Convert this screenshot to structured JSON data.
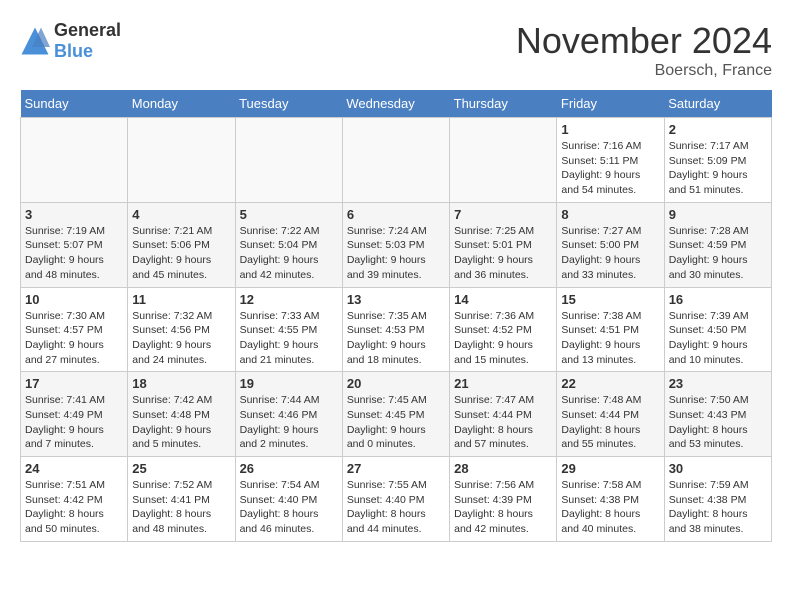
{
  "header": {
    "logo_general": "General",
    "logo_blue": "Blue",
    "title": "November 2024",
    "location": "Boersch, France"
  },
  "weekdays": [
    "Sunday",
    "Monday",
    "Tuesday",
    "Wednesday",
    "Thursday",
    "Friday",
    "Saturday"
  ],
  "weeks": [
    [
      {
        "day": "",
        "info": ""
      },
      {
        "day": "",
        "info": ""
      },
      {
        "day": "",
        "info": ""
      },
      {
        "day": "",
        "info": ""
      },
      {
        "day": "",
        "info": ""
      },
      {
        "day": "1",
        "info": "Sunrise: 7:16 AM\nSunset: 5:11 PM\nDaylight: 9 hours and 54 minutes."
      },
      {
        "day": "2",
        "info": "Sunrise: 7:17 AM\nSunset: 5:09 PM\nDaylight: 9 hours and 51 minutes."
      }
    ],
    [
      {
        "day": "3",
        "info": "Sunrise: 7:19 AM\nSunset: 5:07 PM\nDaylight: 9 hours and 48 minutes."
      },
      {
        "day": "4",
        "info": "Sunrise: 7:21 AM\nSunset: 5:06 PM\nDaylight: 9 hours and 45 minutes."
      },
      {
        "day": "5",
        "info": "Sunrise: 7:22 AM\nSunset: 5:04 PM\nDaylight: 9 hours and 42 minutes."
      },
      {
        "day": "6",
        "info": "Sunrise: 7:24 AM\nSunset: 5:03 PM\nDaylight: 9 hours and 39 minutes."
      },
      {
        "day": "7",
        "info": "Sunrise: 7:25 AM\nSunset: 5:01 PM\nDaylight: 9 hours and 36 minutes."
      },
      {
        "day": "8",
        "info": "Sunrise: 7:27 AM\nSunset: 5:00 PM\nDaylight: 9 hours and 33 minutes."
      },
      {
        "day": "9",
        "info": "Sunrise: 7:28 AM\nSunset: 4:59 PM\nDaylight: 9 hours and 30 minutes."
      }
    ],
    [
      {
        "day": "10",
        "info": "Sunrise: 7:30 AM\nSunset: 4:57 PM\nDaylight: 9 hours and 27 minutes."
      },
      {
        "day": "11",
        "info": "Sunrise: 7:32 AM\nSunset: 4:56 PM\nDaylight: 9 hours and 24 minutes."
      },
      {
        "day": "12",
        "info": "Sunrise: 7:33 AM\nSunset: 4:55 PM\nDaylight: 9 hours and 21 minutes."
      },
      {
        "day": "13",
        "info": "Sunrise: 7:35 AM\nSunset: 4:53 PM\nDaylight: 9 hours and 18 minutes."
      },
      {
        "day": "14",
        "info": "Sunrise: 7:36 AM\nSunset: 4:52 PM\nDaylight: 9 hours and 15 minutes."
      },
      {
        "day": "15",
        "info": "Sunrise: 7:38 AM\nSunset: 4:51 PM\nDaylight: 9 hours and 13 minutes."
      },
      {
        "day": "16",
        "info": "Sunrise: 7:39 AM\nSunset: 4:50 PM\nDaylight: 9 hours and 10 minutes."
      }
    ],
    [
      {
        "day": "17",
        "info": "Sunrise: 7:41 AM\nSunset: 4:49 PM\nDaylight: 9 hours and 7 minutes."
      },
      {
        "day": "18",
        "info": "Sunrise: 7:42 AM\nSunset: 4:48 PM\nDaylight: 9 hours and 5 minutes."
      },
      {
        "day": "19",
        "info": "Sunrise: 7:44 AM\nSunset: 4:46 PM\nDaylight: 9 hours and 2 minutes."
      },
      {
        "day": "20",
        "info": "Sunrise: 7:45 AM\nSunset: 4:45 PM\nDaylight: 9 hours and 0 minutes."
      },
      {
        "day": "21",
        "info": "Sunrise: 7:47 AM\nSunset: 4:44 PM\nDaylight: 8 hours and 57 minutes."
      },
      {
        "day": "22",
        "info": "Sunrise: 7:48 AM\nSunset: 4:44 PM\nDaylight: 8 hours and 55 minutes."
      },
      {
        "day": "23",
        "info": "Sunrise: 7:50 AM\nSunset: 4:43 PM\nDaylight: 8 hours and 53 minutes."
      }
    ],
    [
      {
        "day": "24",
        "info": "Sunrise: 7:51 AM\nSunset: 4:42 PM\nDaylight: 8 hours and 50 minutes."
      },
      {
        "day": "25",
        "info": "Sunrise: 7:52 AM\nSunset: 4:41 PM\nDaylight: 8 hours and 48 minutes."
      },
      {
        "day": "26",
        "info": "Sunrise: 7:54 AM\nSunset: 4:40 PM\nDaylight: 8 hours and 46 minutes."
      },
      {
        "day": "27",
        "info": "Sunrise: 7:55 AM\nSunset: 4:40 PM\nDaylight: 8 hours and 44 minutes."
      },
      {
        "day": "28",
        "info": "Sunrise: 7:56 AM\nSunset: 4:39 PM\nDaylight: 8 hours and 42 minutes."
      },
      {
        "day": "29",
        "info": "Sunrise: 7:58 AM\nSunset: 4:38 PM\nDaylight: 8 hours and 40 minutes."
      },
      {
        "day": "30",
        "info": "Sunrise: 7:59 AM\nSunset: 4:38 PM\nDaylight: 8 hours and 38 minutes."
      }
    ]
  ]
}
